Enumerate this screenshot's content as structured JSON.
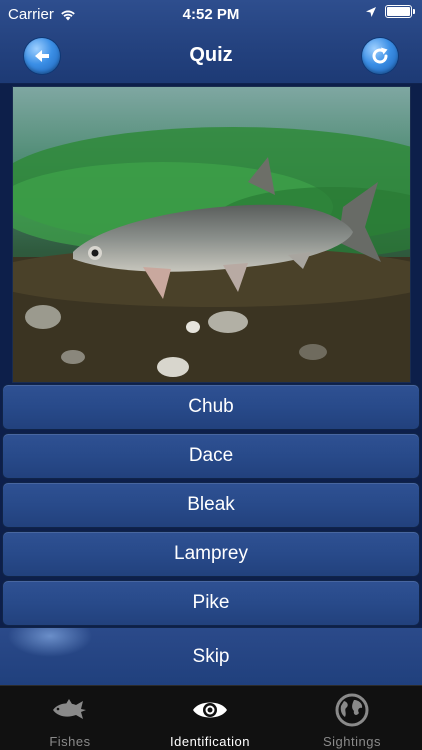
{
  "status_bar": {
    "carrier": "Carrier",
    "time": "4:52 PM",
    "battery_level": 1.0
  },
  "nav": {
    "title": "Quiz",
    "back_icon": "back-arrow-icon",
    "refresh_icon": "refresh-icon"
  },
  "question": {
    "image_subject": "fish-photo"
  },
  "answers": [
    {
      "label": "Chub"
    },
    {
      "label": "Dace"
    },
    {
      "label": "Bleak"
    },
    {
      "label": "Lamprey"
    },
    {
      "label": "Pike"
    }
  ],
  "skip": {
    "label": "Skip"
  },
  "tabs": [
    {
      "label": "Fishes",
      "icon": "fish-icon",
      "active": false
    },
    {
      "label": "Identification",
      "icon": "eye-icon",
      "active": true
    },
    {
      "label": "Sightings",
      "icon": "globe-icon",
      "active": false
    }
  ],
  "colors": {
    "nav_bg": "#24427f",
    "answer_bg": "#284a8a",
    "tab_bar_bg": "#111111",
    "accent_button": "#3b8fe6"
  }
}
